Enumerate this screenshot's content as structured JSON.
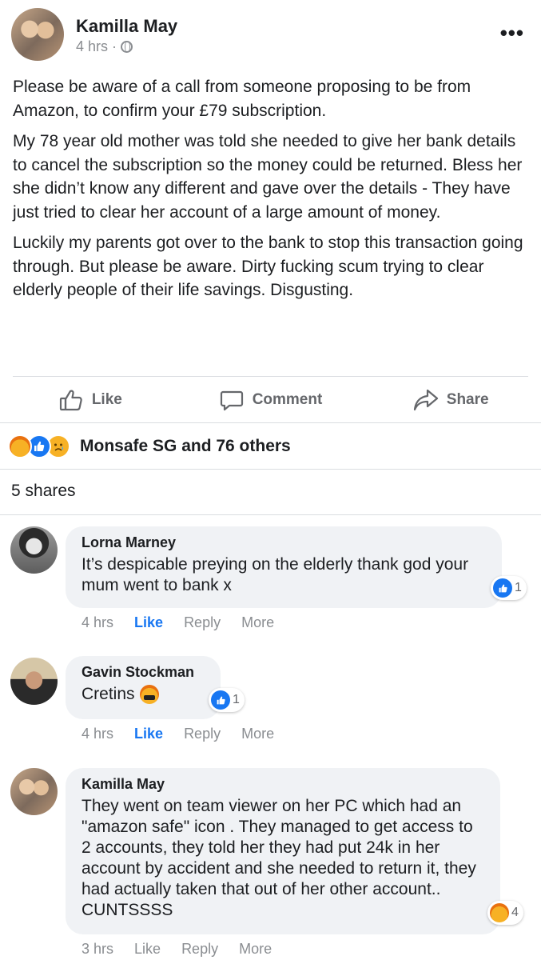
{
  "post": {
    "author": "Kamilla May",
    "time": "4 hrs",
    "more": "•••",
    "paragraphs": [
      "Please be aware of a call from someone proposing to be from Amazon, to confirm your £79 subscription.",
      "My 78 year old mother was told she needed to give her bank details to cancel the subscription so the money could be returned. Bless her she didn’t know any different and gave over the details - They have just tried to clear her account of a large amount of money.",
      "Luckily my parents got over to the bank to stop this transaction going through. But please be aware. Dirty fucking scum trying to clear elderly people of their life savings. Disgusting."
    ]
  },
  "actions": {
    "like": "Like",
    "comment": "Comment",
    "share": "Share"
  },
  "reactions": {
    "icons": [
      "angry-icon",
      "like-icon",
      "sad-icon"
    ],
    "summary": "Monsafe SG and 76 others"
  },
  "shares": "5 shares",
  "comments": [
    {
      "name": "Lorna Marney",
      "text": "It’s despicable preying on the elderly thank god your mum went to bank x",
      "time": "4 hrs",
      "like": "Like",
      "reply": "Reply",
      "more": "More",
      "reaction_count": "1",
      "liked": true
    },
    {
      "name": "Gavin Stockman",
      "text": "Cretins",
      "time": "4 hrs",
      "like": "Like",
      "reply": "Reply",
      "more": "More",
      "reaction_count": "1",
      "liked": true
    },
    {
      "name": "Kamilla May",
      "text": "They went on team viewer on her PC which had an \"amazon safe\" icon . They managed to get access to 2 accounts, they told her they had put 24k in her account by accident and she needed to return it, they had actually taken that out of her other account.. CUNTSSSS",
      "time": "3 hrs",
      "like": "Like",
      "reply": "Reply",
      "more": "More",
      "reaction_count": "4",
      "liked": false
    }
  ],
  "colors": {
    "facebook_blue": "#1877f2",
    "meta_gray": "#8a8d91",
    "bubble_bg": "#f0f2f5"
  }
}
